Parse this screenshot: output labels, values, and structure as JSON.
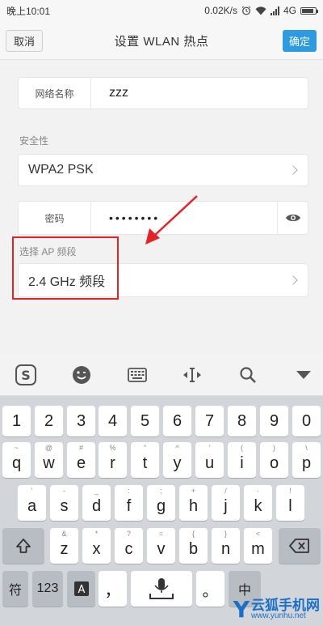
{
  "status": {
    "time": "晚上10:01",
    "speed": "0.02K/s",
    "network": "4G"
  },
  "header": {
    "cancel": "取消",
    "title": "设置 WLAN 热点",
    "ok": "确定"
  },
  "form": {
    "ssid_label": "网络名称",
    "ssid_value": "zzz",
    "security_label": "安全性",
    "security_value": "WPA2 PSK",
    "password_label": "密码",
    "password_value": "••••••••",
    "band_label": "选择 AP 频段",
    "band_value": "2.4 GHz 频段"
  },
  "keyboard": {
    "toolbar_icons": [
      "sogou-logo-icon",
      "emoji-icon",
      "keyboard-icon",
      "cursor-move-icon",
      "search-icon",
      "collapse-keyboard-icon"
    ],
    "row_numbers": [
      "1",
      "2",
      "3",
      "4",
      "5",
      "6",
      "7",
      "8",
      "9",
      "0"
    ],
    "row1": [
      {
        "hint": "~",
        "key": "q"
      },
      {
        "hint": "@",
        "key": "w"
      },
      {
        "hint": "#",
        "key": "e"
      },
      {
        "hint": "%",
        "key": "r"
      },
      {
        "hint": "\"",
        "key": "t"
      },
      {
        "hint": "^",
        "key": "y"
      },
      {
        "hint": "'",
        "key": "u"
      },
      {
        "hint": "(",
        "key": "i"
      },
      {
        "hint": ")",
        "key": "o"
      },
      {
        "hint": "\\",
        "key": "p"
      }
    ],
    "row2": [
      {
        "hint": "'",
        "key": "a"
      },
      {
        "hint": "-",
        "key": "s"
      },
      {
        "hint": "_",
        "key": "d"
      },
      {
        "hint": ":",
        "key": "f"
      },
      {
        "hint": ";",
        "key": "g"
      },
      {
        "hint": "+",
        "key": "h"
      },
      {
        "hint": "/",
        "key": "j"
      },
      {
        "hint": "·",
        "key": "k"
      },
      {
        "hint": "!",
        "key": "l"
      }
    ],
    "row3": [
      {
        "hint": "&",
        "key": "z"
      },
      {
        "hint": "*",
        "key": "x"
      },
      {
        "hint": "?",
        "key": "c"
      },
      {
        "hint": "=",
        "key": "v"
      },
      {
        "hint": "{",
        "key": "b"
      },
      {
        "hint": "}",
        "key": "n"
      },
      {
        "hint": "<",
        "key": "m"
      }
    ],
    "sym": "符",
    "num": "123",
    "comma": "，",
    "lang": "中"
  },
  "watermark": {
    "logo": "Y",
    "name": "云狐手机网",
    "url": "www.yunhu.net"
  }
}
